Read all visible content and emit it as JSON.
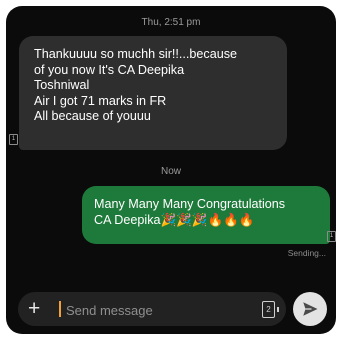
{
  "conversation": {
    "timestamp_top": "Thu, 2:51 pm",
    "timestamp_now": "Now",
    "incoming_message": "Thankuuuu so muchh sir!!...because\nof you now It's CA Deepika\nToshniwal\nAir I got 71 marks in FR\nAll because of youuu",
    "outgoing_message": "Many Many Many Congratulations\nCA Deepika🎉🎉🎉🔥🔥🔥",
    "outgoing_status": "Sending...",
    "sim_label": "1"
  },
  "composer": {
    "placeholder": "Send message",
    "sim_label": "2"
  },
  "icons": {
    "add": "plus-icon",
    "sim_select": "sim-card-icon",
    "send": "send-icon"
  },
  "colors": {
    "background": "#0b0b0b",
    "incoming_bubble": "#2e2e2e",
    "outgoing_bubble": "#1e7a3b",
    "cursor": "#f2a13a"
  }
}
